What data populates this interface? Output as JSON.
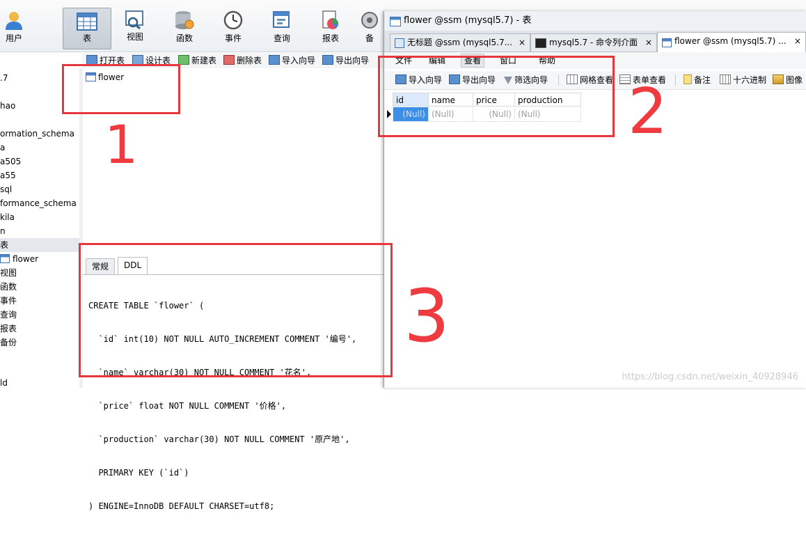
{
  "main_toolbar": {
    "buttons": [
      {
        "label": "用户"
      },
      {
        "label": "表"
      },
      {
        "label": "视图"
      },
      {
        "label": "函数"
      },
      {
        "label": "事件"
      },
      {
        "label": "查询"
      },
      {
        "label": "报表"
      },
      {
        "label": "备"
      }
    ]
  },
  "object_toolbar": {
    "buttons": [
      {
        "label": "打开表"
      },
      {
        "label": "设计表"
      },
      {
        "label": "新建表"
      },
      {
        "label": "删除表"
      },
      {
        "label": "导入向导"
      },
      {
        "label": "导出向导"
      }
    ]
  },
  "left_nav": {
    "items": [
      {
        "label": ".7"
      },
      {
        "label": "hao"
      },
      {
        "label": "ormation_schema"
      },
      {
        "label": "a"
      },
      {
        "label": "a505"
      },
      {
        "label": "a55"
      },
      {
        "label": "sql"
      },
      {
        "label": "formance_schema"
      },
      {
        "label": "kila"
      },
      {
        "label": "n"
      },
      {
        "label": "表"
      },
      {
        "label": "flower"
      },
      {
        "label": "视图"
      },
      {
        "label": "函数"
      },
      {
        "label": "事件"
      },
      {
        "label": "查询"
      },
      {
        "label": "报表"
      },
      {
        "label": "备份"
      },
      {
        "label": "ld"
      }
    ]
  },
  "object_list": {
    "items": [
      {
        "label": "flower"
      }
    ]
  },
  "ddl_panel": {
    "tabs": [
      {
        "label": "常规"
      },
      {
        "label": "DDL"
      }
    ],
    "lines": [
      "CREATE TABLE `flower` (",
      "  `id` int(10) NOT NULL AUTO_INCREMENT COMMENT '编号',",
      "  `name` varchar(30) NOT NULL COMMENT '花名',",
      "  `price` float NOT NULL COMMENT '价格',",
      "  `production` varchar(30) NOT NULL COMMENT '原产地',",
      "  PRIMARY KEY (`id`)",
      ") ENGINE=InnoDB DEFAULT CHARSET=utf8;"
    ]
  },
  "right_window": {
    "title": "flower @ssm (mysql5.7) - 表",
    "tabs": [
      {
        "label": "无标题 @ssm (mysql5.7...",
        "close": "×"
      },
      {
        "label": "mysql5.7 - 命令列介面",
        "close": "×"
      },
      {
        "label": "flower @ssm (mysql5.7) ...",
        "close": "×"
      }
    ],
    "menu": [
      {
        "label": "文件"
      },
      {
        "label": "编辑"
      },
      {
        "label": "查看"
      },
      {
        "label": "窗口"
      },
      {
        "label": "帮助"
      }
    ],
    "toolbar": [
      {
        "label": "导入向导"
      },
      {
        "label": "导出向导"
      },
      {
        "label": "筛选向导"
      },
      {
        "label": "网格查看"
      },
      {
        "label": "表单查看"
      },
      {
        "label": "备注"
      },
      {
        "label": "十六进制"
      },
      {
        "label": "图像"
      }
    ],
    "grid": {
      "columns": [
        "id",
        "name",
        "price",
        "production"
      ],
      "row": [
        "(Null)",
        "(Null)",
        "(Null)",
        "(Null)"
      ]
    }
  },
  "annotations": [
    "1",
    "2",
    "3"
  ],
  "watermark": "https://blog.csdn.net/weixin_40928946",
  "colors": {
    "annotation_red": "#e8373c",
    "selected_cell": "#3d8ee6"
  }
}
